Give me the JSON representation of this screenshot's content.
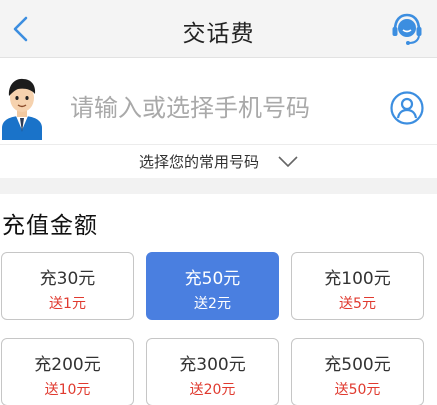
{
  "header": {
    "title": "交话费",
    "back_icon": "back-chevron-icon",
    "service_icon": "customer-service-icon",
    "accent": "#3c8ee0"
  },
  "phone": {
    "placeholder": "请输入或选择手机号码",
    "avatar_icon": "user-avatar",
    "contact_icon": "contacts-icon"
  },
  "common_numbers": {
    "label": "选择您的常用号码",
    "icon": "chevron-down-icon"
  },
  "recharge": {
    "section_title": "充值金额",
    "selected_color": "#4a7fe0",
    "bonus_color": "#e03a2f",
    "options": [
      {
        "label": "充30元",
        "bonus": "送1元",
        "selected": false
      },
      {
        "label": "充50元",
        "bonus": "送2元",
        "selected": true
      },
      {
        "label": "充100元",
        "bonus": "送5元",
        "selected": false
      },
      {
        "label": "充200元",
        "bonus": "送10元",
        "selected": false
      },
      {
        "label": "充300元",
        "bonus": "送20元",
        "selected": false
      },
      {
        "label": "充500元",
        "bonus": "送50元",
        "selected": false
      }
    ]
  }
}
